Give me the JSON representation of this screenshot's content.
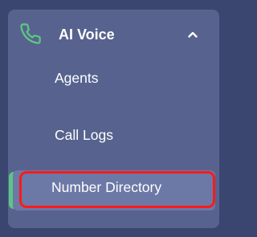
{
  "section": {
    "title": "AI Voice",
    "icon": "phone-icon",
    "toggle_icon": "chevron-up-icon",
    "expanded": true
  },
  "items": [
    {
      "label": "Agents",
      "active": false
    },
    {
      "label": "Call Logs",
      "active": false
    },
    {
      "label": "Number Directory",
      "active": true
    }
  ],
  "colors": {
    "page_bg": "#3a4670",
    "panel_bg": "#57638e",
    "active_bg": "#6c78a6",
    "accent": "#5dc583",
    "highlight": "#ff1a1a",
    "text": "#ffffff"
  }
}
